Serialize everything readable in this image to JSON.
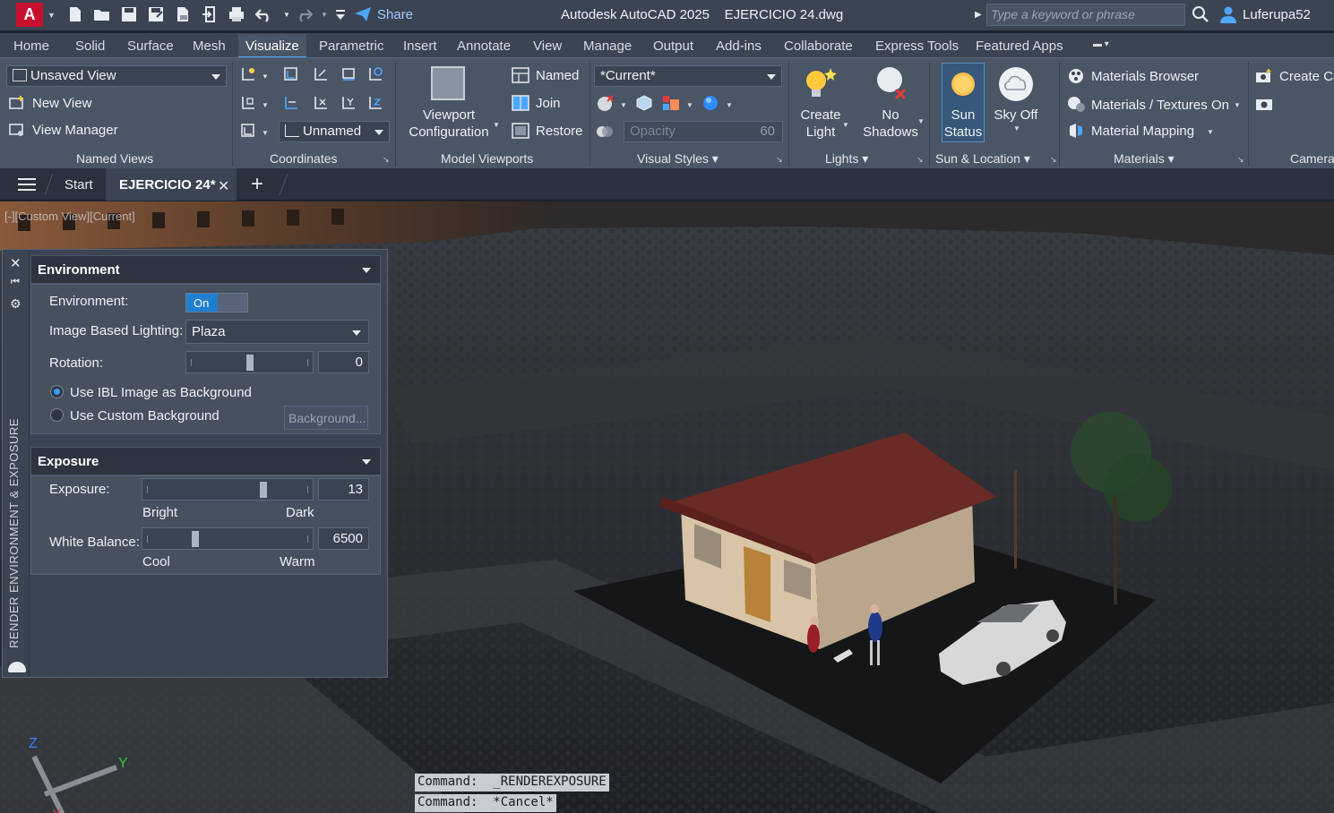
{
  "titlebar": {
    "app_letter": "A",
    "share_label": "Share",
    "app_title": "Autodesk AutoCAD 2025",
    "doc_title": "EJERCICIO 24.dwg",
    "search_placeholder": "Type a keyword or phrase",
    "username": "Luferupa52"
  },
  "menu_tabs": [
    "Home",
    "Solid",
    "Surface",
    "Mesh",
    "Visualize",
    "Parametric",
    "Insert",
    "Annotate",
    "View",
    "Manage",
    "Output",
    "Add-ins",
    "Collaborate",
    "Express Tools",
    "Featured Apps"
  ],
  "active_tab": "Visualize",
  "ribbon": {
    "named_views": {
      "title": "Named Views",
      "current_view": "Unsaved View",
      "new_view": "New View",
      "view_manager": "View Manager"
    },
    "coordinates": {
      "title": "Coordinates",
      "ucs_name": "Unnamed"
    },
    "model_viewports": {
      "title": "Model Viewports",
      "config_label_1": "Viewport",
      "config_label_2": "Configuration",
      "named": "Named",
      "join": "Join",
      "restore": "Restore"
    },
    "visual_styles": {
      "title": "Visual Styles",
      "current": "*Current*",
      "opacity_label": "Opacity",
      "opacity_value": "60"
    },
    "lights": {
      "title": "Lights",
      "create_light_1": "Create",
      "create_light_2": "Light",
      "shadows_1": "No",
      "shadows_2": "Shadows"
    },
    "sun_location": {
      "title": "Sun & Location",
      "sun_status_1": "Sun",
      "sun_status_2": "Status",
      "sky": "Sky Off"
    },
    "materials": {
      "title": "Materials",
      "browser": "Materials Browser",
      "textures": "Materials / Textures On",
      "mapping": "Material Mapping"
    },
    "camera": {
      "title": "Camera",
      "create_camera": "Create Ca"
    }
  },
  "file_tabs": {
    "start": "Start",
    "active": "EJERCICIO 24*"
  },
  "viewport": {
    "label": "[-][Custom View][Current]"
  },
  "render_palette": {
    "strip_title": "RENDER ENVIRONMENT & EXPOSURE",
    "environment": {
      "header": "Environment",
      "env_label": "Environment:",
      "env_toggle": "On",
      "ibl_label": "Image Based Lighting:",
      "ibl_value": "Plaza",
      "rotation_label": "Rotation:",
      "rotation_value": "0",
      "rotation_fraction": 0.5,
      "use_ibl_bg": "Use IBL Image as Background",
      "use_custom_bg": "Use Custom Background",
      "background_button": "Background..."
    },
    "exposure": {
      "header": "Exposure",
      "exposure_label": "Exposure:",
      "exposure_value": "13",
      "exposure_fraction": 0.72,
      "bright": "Bright",
      "dark": "Dark",
      "wb_label": "White Balance:",
      "wb_value": "6500",
      "wb_fraction": 0.3,
      "cool": "Cool",
      "warm": "Warm"
    }
  },
  "command_history": [
    "Command:  _RENDEREXPOSURE",
    "Command:  *Cancel*"
  ],
  "ucs": {
    "x": "X",
    "y": "Y",
    "z": "Z"
  },
  "colors": {
    "accent": "#1e7fd0",
    "brand_red": "#c8102e",
    "ribbon_bg": "#4a5566",
    "title_bg": "#3b4453"
  }
}
